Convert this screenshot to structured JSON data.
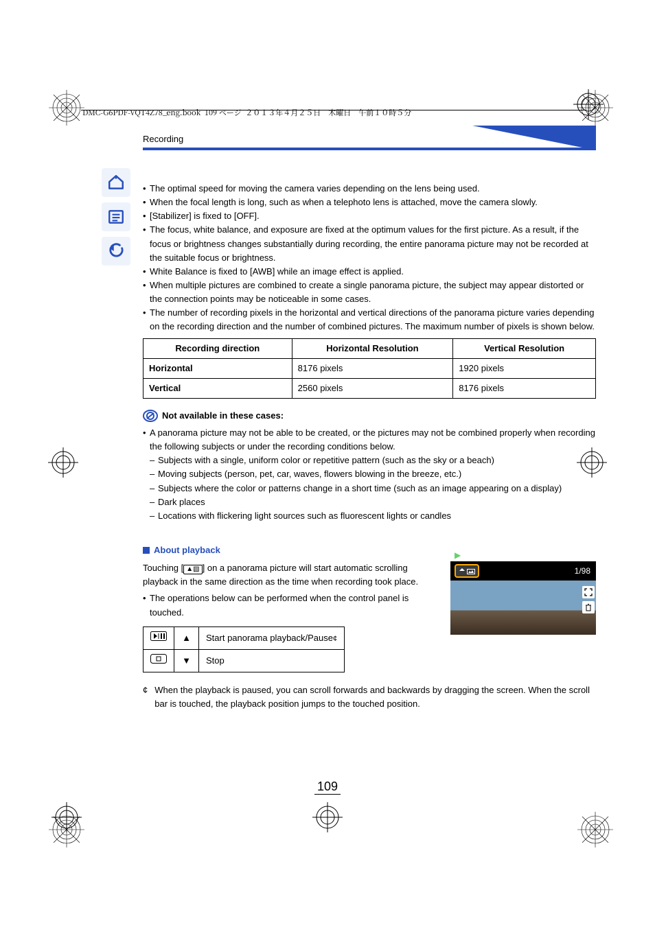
{
  "framemaker_header": "DMC-G6PDF-VQT4Z78_eng.book  109 ページ  ２０１３年４月２５日　木曜日　午前１０時５分",
  "section_label": "Recording",
  "bullets_top": [
    "The optimal speed for moving the camera varies depending on the lens being used.",
    "When the focal length is long, such as when a telephoto lens is attached, move the camera slowly.",
    "[Stabilizer] is fixed to [OFF].",
    "The focus, white balance, and exposure are fixed at the optimum values for the first picture. As a result, if the focus or brightness changes substantially during recording, the entire panorama picture may not be recorded at the suitable focus or brightness.",
    "White Balance is fixed to [AWB] while an image effect is applied.",
    "When multiple pictures are combined to create a single panorama picture, the subject may appear distorted or the connection points may be noticeable in some cases.",
    "The number of recording pixels in the horizontal and vertical directions of the panorama picture varies depending on the recording direction and the number of combined pictures. The maximum number of pixels is shown below."
  ],
  "res_table": {
    "headers": [
      "Recording direction",
      "Horizontal Resolution",
      "Vertical Resolution"
    ],
    "rows": [
      {
        "dir": "Horizontal",
        "h": "8176 pixels",
        "v": "1920 pixels"
      },
      {
        "dir": "Vertical",
        "h": "2560 pixels",
        "v": "8176 pixels"
      }
    ]
  },
  "not_avail_title": "Not available in these cases:",
  "not_avail_lead": "A panorama picture may not be able to be created, or the pictures may not be combined properly when recording the following subjects or under the recording conditions below.",
  "not_avail_items": [
    "Subjects with a single, uniform color or repetitive pattern (such as the sky or a beach)",
    "Moving subjects (person, pet, car, waves, flowers blowing in the breeze, etc.)",
    "Subjects where the color or patterns change in a short time (such as an image appearing on a display)",
    "Dark places",
    "Locations with flickering light sources such as fluorescent lights or candles"
  ],
  "about_playback_title": "About playback",
  "about_playback_lead_pre": "Touching [",
  "about_playback_lead_post": "] on a panorama picture will start automatic scrolling playback in the same direction as the time when recording took place.",
  "about_playback_bullet": "The operations below can be performed when the control panel is touched.",
  "thumb_count": "1/98",
  "ctrl_table": {
    "rows": [
      {
        "arrow": "▲",
        "label": "Start panorama playback/Pause",
        "star": "¢"
      },
      {
        "arrow": "▼",
        "label": "Stop",
        "star": ""
      }
    ]
  },
  "footnote_star": "¢",
  "footnote_text": "When the playback is paused, you can scroll forwards and backwards by dragging the screen. When the scroll bar is touched, the playback position jumps to the touched position.",
  "page_number": "109",
  "sidebar_icons": [
    "home-icon",
    "index-icon",
    "back-icon"
  ]
}
